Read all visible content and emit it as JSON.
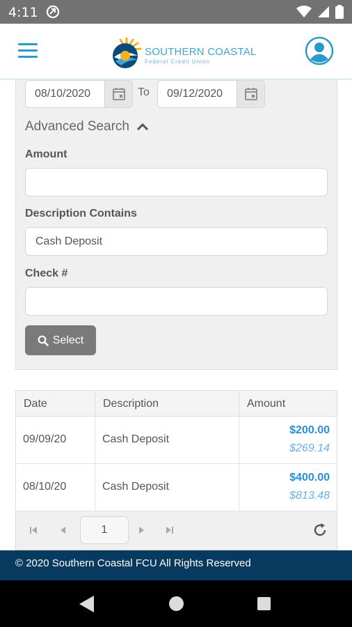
{
  "status_bar": {
    "time": "4:11"
  },
  "header": {
    "brand_name": "SOUTHERN COASTAL",
    "brand_sub": "Federal Credit Union",
    "colors": {
      "accent": "#2a9bc9",
      "brand_text": "#3ea6cf"
    }
  },
  "search": {
    "date_from": "08/10/2020",
    "date_to": "09/12/2020",
    "to_label": "To",
    "advanced_label": "Advanced Search",
    "amount_label": "Amount",
    "amount_value": "",
    "description_label": "Description Contains",
    "description_value": "Cash Deposit",
    "check_label": "Check #",
    "check_value": "",
    "select_label": "Select"
  },
  "table": {
    "headers": [
      "Date",
      "Description",
      "Amount"
    ],
    "rows": [
      {
        "date": "09/09/20",
        "description": "Cash Deposit",
        "amount": "$200.00",
        "balance": "$269.14"
      },
      {
        "date": "08/10/20",
        "description": "Cash Deposit",
        "amount": "$400.00",
        "balance": "$813.48"
      }
    ]
  },
  "pager": {
    "page": "1"
  },
  "footer": {
    "text": "© 2020 Southern Coastal FCU All Rights Reserved"
  }
}
